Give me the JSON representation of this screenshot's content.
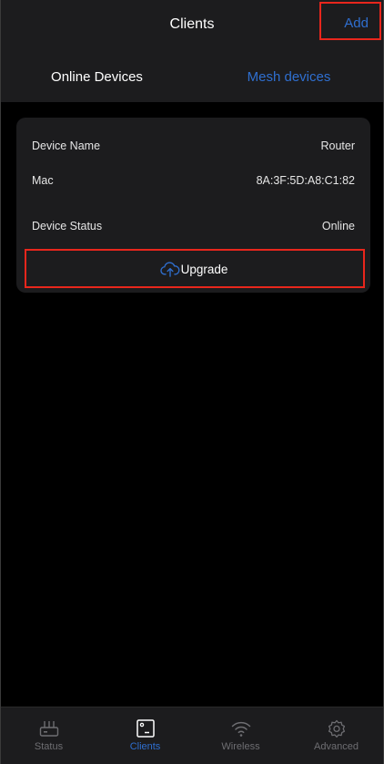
{
  "header": {
    "title": "Clients",
    "add_label": "Add"
  },
  "tabs": [
    {
      "label": "Online Devices",
      "active": true
    },
    {
      "label": "Mesh devices",
      "active": false
    }
  ],
  "device_card": {
    "rows": [
      {
        "label": "Device Name",
        "value": "Router"
      },
      {
        "label": "Mac",
        "value": "8A:3F:5D:A8:C1:82"
      },
      {
        "label": "Device Status",
        "value": "Online"
      }
    ],
    "upgrade_label": "Upgrade",
    "upgrade_icon": "cloud-upload-icon"
  },
  "bottom_nav": [
    {
      "label": "Status",
      "icon": "router-icon",
      "active": false
    },
    {
      "label": "Clients",
      "icon": "client-device-icon",
      "active": true
    },
    {
      "label": "Wireless",
      "icon": "wifi-icon",
      "active": false
    },
    {
      "label": "Advanced",
      "icon": "gear-icon",
      "active": false
    }
  ],
  "colors": {
    "accent": "#2f6fd0",
    "highlight": "#e8261c",
    "panel": "#1c1c1e",
    "background": "#000000",
    "inactive": "#6e6e72"
  }
}
